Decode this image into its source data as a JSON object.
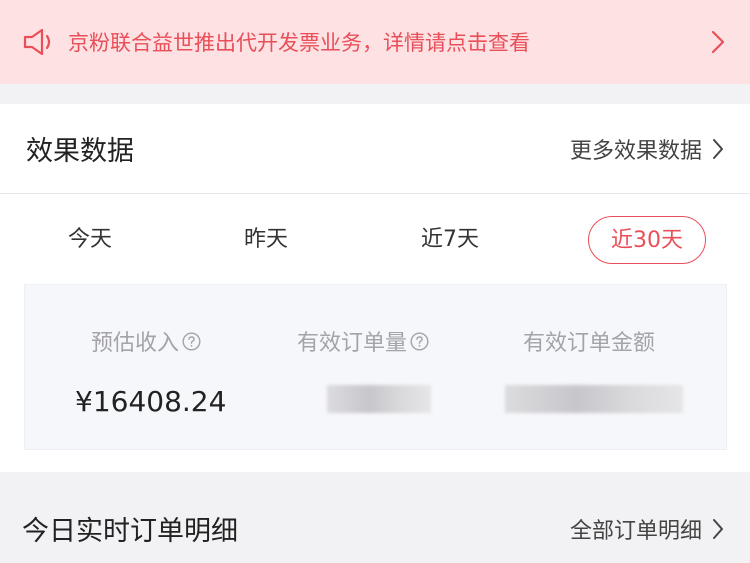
{
  "notice": {
    "text": "京粉联合益世推出代开发票业务，详情请点击查看",
    "color": "#e94f58",
    "background": "#fde1e3"
  },
  "effect_card": {
    "title": "效果数据",
    "more_label": "更多效果数据"
  },
  "tabs": [
    {
      "label": "今天",
      "active": false
    },
    {
      "label": "昨天",
      "active": false
    },
    {
      "label": "近7天",
      "active": false
    },
    {
      "label": "近30天",
      "active": true
    }
  ],
  "stats": [
    {
      "label": "预估收入",
      "value": "¥16408.24",
      "has_help": true
    },
    {
      "label": "有效订单量",
      "value": "",
      "has_help": true
    },
    {
      "label": "有效订单金额",
      "value": "",
      "has_help": false
    }
  ],
  "orders_section": {
    "title": "今日实时订单明细",
    "more_label": "全部订单明细"
  },
  "colors": {
    "accent": "#e94f58",
    "text_primary": "#222222",
    "text_muted": "#a3a3a8"
  }
}
